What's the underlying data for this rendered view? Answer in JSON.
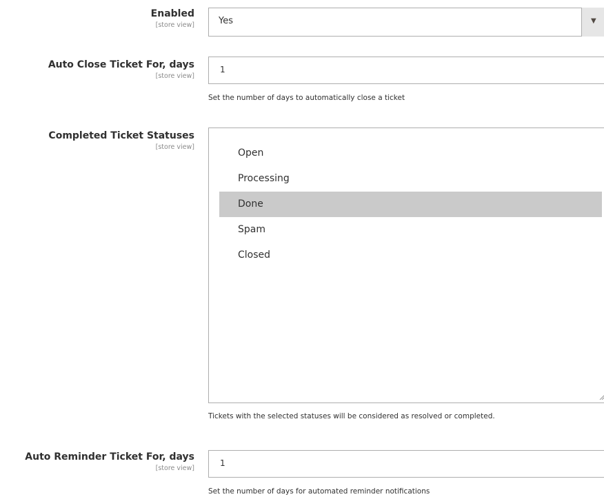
{
  "enabled": {
    "label": "Enabled",
    "scope": "[store view]",
    "value": "Yes"
  },
  "auto_close": {
    "label": "Auto Close Ticket For, days",
    "scope": "[store view]",
    "value": "1",
    "note": "Set the number of days to automatically close a ticket"
  },
  "completed_statuses": {
    "label": "Completed Ticket Statuses",
    "scope": "[store view]",
    "options": [
      {
        "label": "Open",
        "selected": false
      },
      {
        "label": "Processing",
        "selected": false
      },
      {
        "label": "Done",
        "selected": true
      },
      {
        "label": "Spam",
        "selected": false
      },
      {
        "label": "Closed",
        "selected": false
      }
    ],
    "note": "Tickets with the selected statuses will be considered as resolved or completed."
  },
  "auto_reminder": {
    "label": "Auto Reminder Ticket For, days",
    "scope": "[store view]",
    "value": "1",
    "note": "Set the number of days for automated reminder notifications"
  }
}
